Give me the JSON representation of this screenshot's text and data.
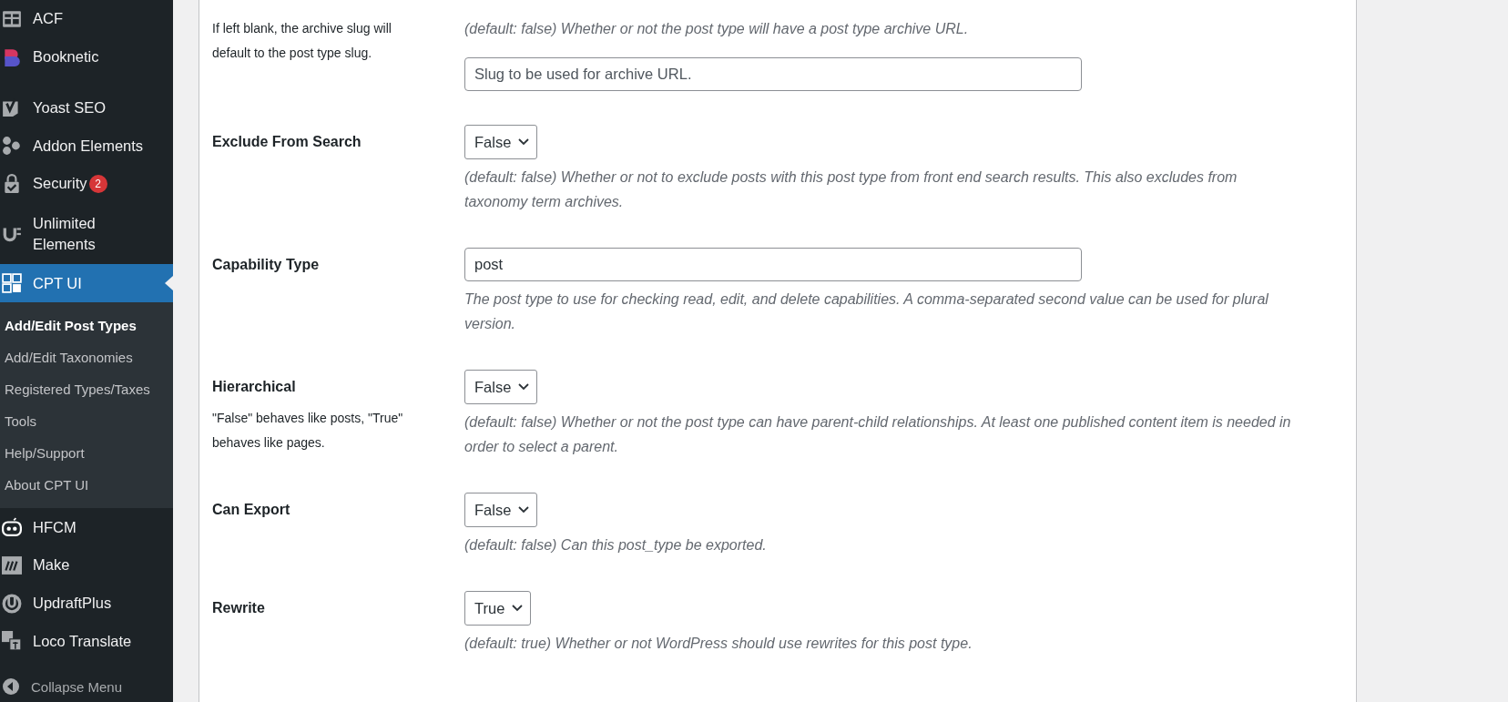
{
  "sidebar": {
    "menu": [
      {
        "label": "ACF",
        "selected": false
      },
      {
        "label": "Booknetic",
        "selected": false
      },
      {
        "label": "Yoast SEO",
        "selected": false
      },
      {
        "label": "Addon Elements",
        "selected": false
      },
      {
        "label": "Security",
        "badge": "2",
        "selected": false
      },
      {
        "label": "Unlimited Elements",
        "selected": false
      },
      {
        "label": "CPT UI",
        "selected": true,
        "children": [
          {
            "label": "Add/Edit Post Types",
            "selected": true
          },
          {
            "label": "Add/Edit Taxonomies",
            "selected": false
          },
          {
            "label": "Registered Types/Taxes",
            "selected": false
          },
          {
            "label": "Tools",
            "selected": false
          },
          {
            "label": "Help/Support",
            "selected": false
          },
          {
            "label": "About CPT UI",
            "selected": false
          }
        ]
      },
      {
        "label": "HFCM",
        "selected": false
      },
      {
        "label": "Make",
        "selected": false
      },
      {
        "label": "UpdraftPlus",
        "selected": false
      },
      {
        "label": "Loco Translate",
        "selected": false
      }
    ],
    "collapse_menu": "Collapse Menu"
  },
  "settings": [
    {
      "help": "If left blank, the archive slug will default to the post type slug.",
      "description": "(default: false) Whether or not the post type will have a post type archive URL.",
      "field_below": {
        "kind": "text",
        "placeholder": "Slug to be used for archive URL."
      }
    },
    {
      "label": "Exclude From Search",
      "field": {
        "kind": "select",
        "value": "False"
      },
      "description": "(default: false) Whether or not to exclude posts with this post type from front end search results. This also excludes from taxonomy term archives."
    },
    {
      "label": "Capability Type",
      "field": {
        "kind": "text",
        "value": "post"
      },
      "description": "The post type to use for checking read, edit, and delete capabilities. A comma-separated second value can be used for plural version."
    },
    {
      "label": "Hierarchical",
      "help": "\"False\" behaves like posts, \"True\" behaves like pages.",
      "field": {
        "kind": "select",
        "value": "False"
      },
      "description": "(default: false) Whether or not the post type can have parent-child relationships. At least one published content item is needed in order to select a parent."
    },
    {
      "label": "Can Export",
      "field": {
        "kind": "select",
        "value": "False"
      },
      "description": "(default: false) Can this post_type be exported."
    },
    {
      "label": "Rewrite",
      "field": {
        "kind": "select",
        "value": "True"
      },
      "description": "(default: true) Whether or not WordPress should use rewrites for this post type."
    }
  ]
}
